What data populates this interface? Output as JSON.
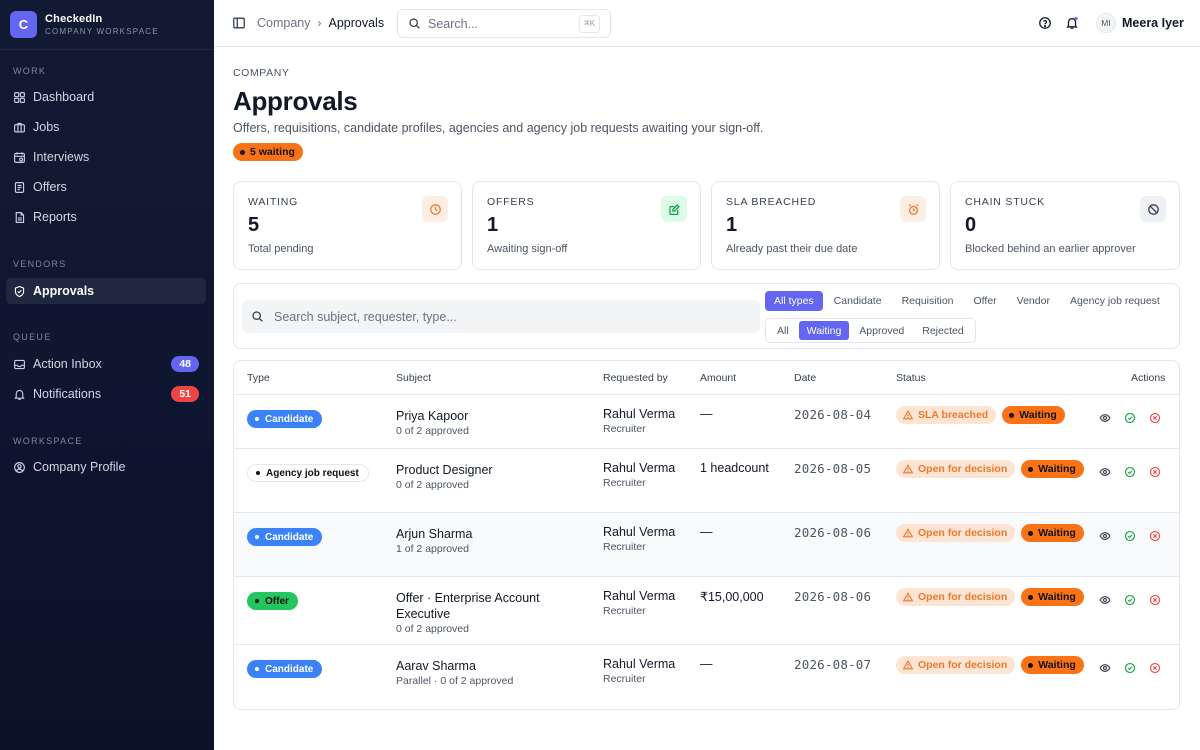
{
  "app": {
    "logo_letter": "C",
    "name": "CheckedIn",
    "subtitle": "COMPANY WORKSPACE"
  },
  "sidebar": {
    "sections": [
      {
        "label": "WORK"
      },
      {
        "label": "VENDORS"
      },
      {
        "label": "QUEUE"
      },
      {
        "label": "WORKSPACE"
      }
    ],
    "items": [
      {
        "label": "Dashboard",
        "icon": "grid-icon"
      },
      {
        "label": "Jobs",
        "icon": "briefcase-icon"
      },
      {
        "label": "Interviews",
        "icon": "calendar-icon"
      },
      {
        "label": "Offers",
        "icon": "document-icon"
      },
      {
        "label": "Reports",
        "icon": "report-icon"
      },
      {
        "label": "Approvals",
        "icon": "shield-icon",
        "active": true
      },
      {
        "label": "Action Inbox",
        "icon": "inbox-icon",
        "badge": "48",
        "badge_color": "#6366f1"
      },
      {
        "label": "Notifications",
        "icon": "bell-icon",
        "badge": "51",
        "badge_color": "#ef4444"
      },
      {
        "label": "Company Profile",
        "icon": "user-circle-icon"
      }
    ]
  },
  "topbar": {
    "breadcrumb": [
      "Company",
      "Approvals"
    ],
    "search_placeholder": "Search...",
    "search_shortcut": "⌘K",
    "user_initials": "MI",
    "user_name": "Meera Iyer"
  },
  "page": {
    "eyebrow": "COMPANY",
    "title": "Approvals",
    "description": "Offers, requisitions, candidate profiles, agencies and agency job requests awaiting your sign-off.",
    "waiting_pill": "5 waiting"
  },
  "stats": [
    {
      "label": "WAITING",
      "value": "5",
      "hint": "Total pending",
      "icon": "clock-icon",
      "icon_bg": "#fdeee3",
      "icon_color": "#ea7a2c"
    },
    {
      "label": "OFFERS",
      "value": "1",
      "hint": "Awaiting sign-off",
      "icon": "edit-icon",
      "icon_bg": "#dcfce7",
      "icon_color": "#16a34a"
    },
    {
      "label": "SLA BREACHED",
      "value": "1",
      "hint": "Already past their due date",
      "icon": "alarm-icon",
      "icon_bg": "#fdeee3",
      "icon_color": "#ea7a2c"
    },
    {
      "label": "CHAIN STUCK",
      "value": "0",
      "hint": "Blocked behind an earlier approver",
      "icon": "blocked-icon",
      "icon_bg": "#eef0f3",
      "icon_color": "#374151"
    }
  ],
  "filters": {
    "search_placeholder": "Search subject, requester, type...",
    "type_tabs": [
      "All types",
      "Candidate",
      "Requisition",
      "Offer",
      "Vendor",
      "Agency job request"
    ],
    "type_active": "All types",
    "status_tabs": [
      "All",
      "Waiting",
      "Approved",
      "Rejected"
    ],
    "status_active": "Waiting"
  },
  "table": {
    "columns": [
      "Type",
      "Subject",
      "Requested by",
      "Amount",
      "Date",
      "Status",
      "Actions"
    ],
    "rows": [
      {
        "type": "Candidate",
        "subject": "Priya Kapoor",
        "subject_sub": "0 of 2 approved",
        "requester": "Rahul Verma",
        "requester_role": "Recruiter",
        "amount": "—",
        "date": "2026-08-04",
        "status_primary": "SLA breached",
        "status_secondary": "Waiting"
      },
      {
        "type": "Agency job request",
        "subject": "Product Designer",
        "subject_sub": "0 of 2 approved",
        "requester": "Rahul Verma",
        "requester_role": "Recruiter",
        "amount": "1 headcount",
        "date": "2026-08-05",
        "status_primary": "Open for decision",
        "status_secondary": "Waiting"
      },
      {
        "type": "Candidate",
        "subject": "Arjun Sharma",
        "subject_sub": "1 of 2 approved",
        "requester": "Rahul Verma",
        "requester_role": "Recruiter",
        "amount": "—",
        "date": "2026-08-06",
        "status_primary": "Open for decision",
        "status_secondary": "Waiting"
      },
      {
        "type": "Offer",
        "subject": "Offer · Enterprise Account Executive",
        "subject_sub": "0 of 2 approved",
        "requester": "Rahul Verma",
        "requester_role": "Recruiter",
        "amount": "₹15,00,000",
        "date": "2026-08-06",
        "status_primary": "Open for decision",
        "status_secondary": "Waiting"
      },
      {
        "type": "Candidate",
        "subject": "Aarav Sharma",
        "subject_sub": "Parallel · 0 of 2 approved",
        "requester": "Rahul Verma",
        "requester_role": "Recruiter",
        "amount": "—",
        "date": "2026-08-07",
        "status_primary": "Open for decision",
        "status_secondary": "Waiting"
      }
    ]
  },
  "colors": {
    "accent": "#6366f1",
    "candidate": "#3b82f6",
    "offer": "#22c55e",
    "waiting": "#f97316",
    "sla_breached_bg": "#fde4d3",
    "danger": "#ef4444",
    "success": "#16a34a"
  }
}
